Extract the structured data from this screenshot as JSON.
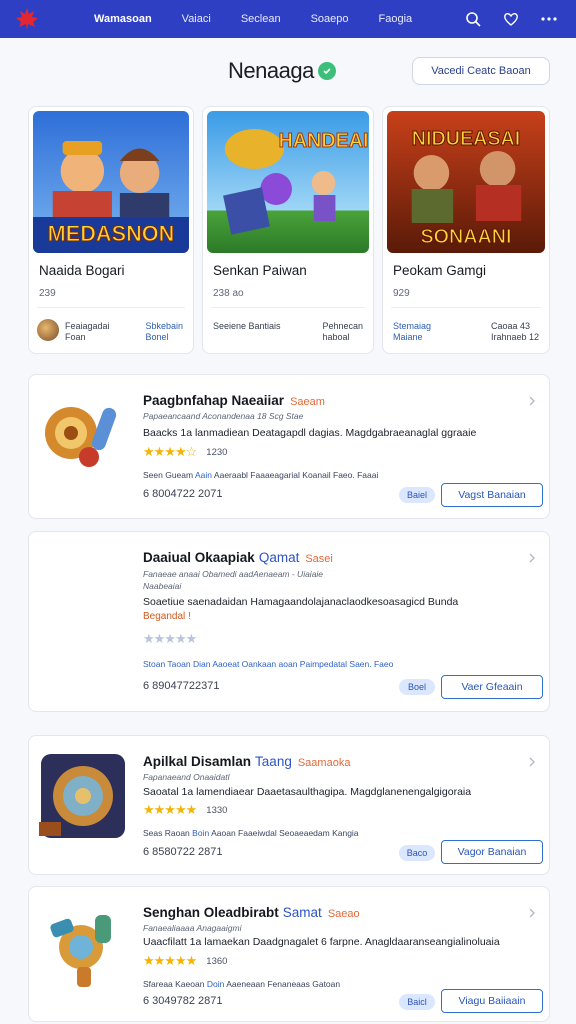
{
  "topbar": {
    "nav": [
      "Wamasoan",
      "Vaiaci",
      "Seclean",
      "Soaepo",
      "Faogia"
    ],
    "accent": "#2f3fc4"
  },
  "header": {
    "brand": "Nenaaga",
    "action_button": "Vacedi Ceatc Baoan"
  },
  "featured": [
    {
      "title": "Naaida Bogari",
      "sub": "239",
      "meta_left": "Feaiagadai\nFoan",
      "meta_right": "Sbkebain\nBonel",
      "banner": "MEDASNON"
    },
    {
      "title": "Senkan Paiwan",
      "sub": "238 ao",
      "meta_left": "Seeiene Bantiais",
      "meta_right": "Pehnecan\nhaboal",
      "banner": "HANDEAI"
    },
    {
      "title": "Peokam Gamgi",
      "sub": "929",
      "meta_left": "Stemaiag\nMaiane",
      "meta_right": "Caoaa 43\nIrahnaeb 12",
      "banner": "SONAANI",
      "banner_top": "NIDUEASAI"
    }
  ],
  "items": [
    {
      "title": "Paagbnfahap Naeaiiar",
      "title2": "Saeam",
      "sub": "Papaeancaand Aconandenaa 18 Scg Stae",
      "desc": "Baacks 1a lanmadiean Deatagapdl dagias. Magdgabraeanaglal ggraaie",
      "rating": "1230",
      "link": "Seen Gueam",
      "link2": "Aain",
      "link3": "Aaeraabl Faaaeagarial Koanail Faeo. Faaai",
      "code": "6 8004722 2071",
      "chip": "Baiel",
      "button": "Vagst Banaian"
    },
    {
      "title": "Daaiual Okaapiak",
      "title2": "Qamat",
      "title3": "Sasei",
      "sub": "Fanaeae anaai Obamedi aadAenaeam - Uiaiaie",
      "sub2": "Naabeaiai",
      "desc": "Soaetiue saenadaidan Hamagaandolajanaclaodkesoasagicd Bunda",
      "desc2": "Begandal !",
      "link": "Stoan Taoan",
      "link2": "Dian",
      "link3": "Aaoeat Oankaan aoan Paimpedatal Saen. Faeo",
      "code": "6 89047722371",
      "chip": "Boel",
      "button": "Vaer Gfeaain"
    },
    {
      "title": "Apilkal Disamlan",
      "title2": "Taang",
      "title3": "Saamaoka",
      "sub": "Fapanaeand Onaaidatl",
      "desc": "Saoatal 1a lamendiaear Daaetasaulthagipa. Magdglanenengalgigoraia",
      "rating": "1330",
      "link": "Seas Raoan",
      "link2": "Boin",
      "link3": "Aaoan Faaeiwdal Seoaeaedam Kangia",
      "code": "6 8580722 2871",
      "chip": "Baco",
      "button": "Vagor Banaian"
    },
    {
      "title": "Senghan Oleadbirabt",
      "title2": "Samat",
      "title3": "Saeao",
      "sub": "Fanaealiaaaa Anagaaigmi",
      "desc": "Uaacfilatt 1a lamaekan Daadgnagalet 6 farpne. Anagldaaranseangialinoluaia",
      "rating": "1360",
      "link": "Sfareaa Kaeoan",
      "link2": "Doin",
      "link3": "Aaeneaan Fenaneaas Gatoan",
      "code": "6 3049782 2871",
      "chip": "Baicl",
      "button": "Viagu Baiiaain"
    }
  ]
}
